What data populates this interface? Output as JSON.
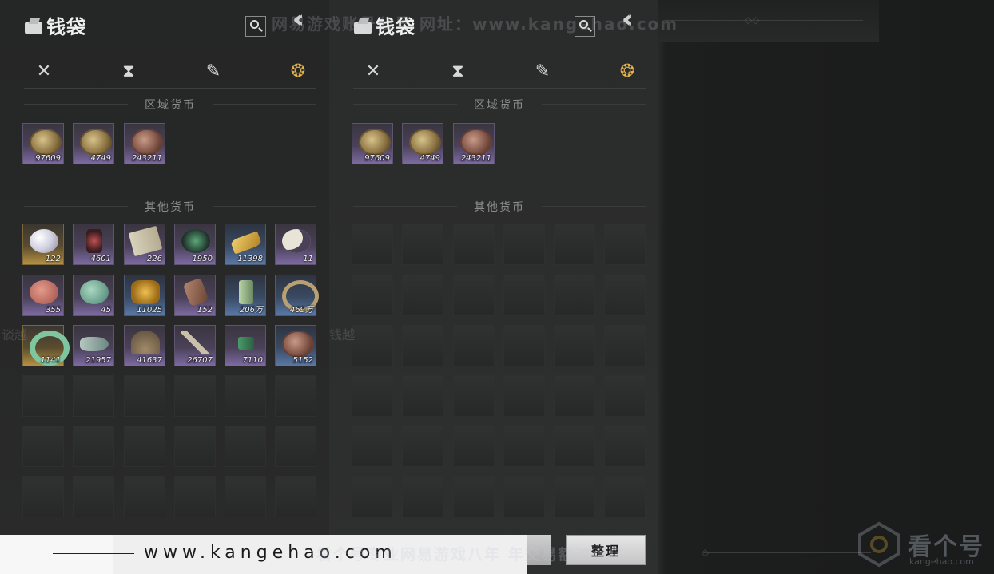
{
  "watermarks": {
    "top": "网易游戏账号公号  网址：www.kangehao.com",
    "bottom": "看个号专业网易游戏八年  年交易额过百亿",
    "logo_text": "看个号",
    "logo_sub": "kangehao.com",
    "side_left": "谈越",
    "side_right": "钱越",
    "url": "www.kangehao.com"
  },
  "panels": [
    {
      "title": "钱袋",
      "tabs": [
        {
          "name": "weapons",
          "glyph": "✕",
          "active": false
        },
        {
          "name": "bag",
          "glyph": "⧗",
          "active": false
        },
        {
          "name": "scroll",
          "glyph": "✎",
          "active": false
        },
        {
          "name": "currency",
          "glyph": "❂",
          "active": true
        }
      ],
      "section_regional": "区域货币",
      "section_other": "其他货币",
      "regional": [
        {
          "icon": "coin",
          "qty": "97609",
          "quality": "purple"
        },
        {
          "icon": "coin",
          "qty": "4749",
          "quality": "purple"
        },
        {
          "icon": "coin-copper",
          "qty": "243211",
          "quality": "purple"
        }
      ],
      "other": [
        {
          "icon": "pearl",
          "qty": "122",
          "quality": "gold"
        },
        {
          "icon": "crystal",
          "qty": "4601",
          "quality": "purple"
        },
        {
          "icon": "paper",
          "qty": "226",
          "quality": "purple"
        },
        {
          "icon": "sprout",
          "qty": "1950",
          "quality": "purple"
        },
        {
          "icon": "goldbar",
          "qty": "11398",
          "quality": "blue"
        },
        {
          "icon": "moon",
          "qty": "11",
          "quality": "purple"
        },
        {
          "icon": "pinkball",
          "qty": "355",
          "quality": "purple"
        },
        {
          "icon": "jadeball",
          "qty": "45",
          "quality": "purple"
        },
        {
          "icon": "goldleaf",
          "qty": "11025",
          "quality": "blue"
        },
        {
          "icon": "brownbar",
          "qty": "152",
          "quality": "purple"
        },
        {
          "icon": "ticket",
          "qty": "206万",
          "quality": "blue"
        },
        {
          "icon": "bracelet",
          "qty": "469万",
          "quality": "blue"
        },
        {
          "icon": "jadering",
          "qty": "1141",
          "quality": "gold"
        },
        {
          "icon": "fish",
          "qty": "21957",
          "quality": "purple"
        },
        {
          "icon": "dome",
          "qty": "41637",
          "quality": "purple"
        },
        {
          "icon": "key",
          "qty": "26707",
          "quality": "purple"
        },
        {
          "icon": "note",
          "qty": "7110",
          "quality": "purple"
        },
        {
          "icon": "coin-copper",
          "qty": "5152",
          "quality": "blue"
        }
      ],
      "empty_rows": 3
    },
    {
      "title": "钱袋",
      "tabs": [
        {
          "name": "weapons",
          "glyph": "✕",
          "active": false
        },
        {
          "name": "bag",
          "glyph": "⧗",
          "active": false
        },
        {
          "name": "scroll",
          "glyph": "✎",
          "active": false
        },
        {
          "name": "currency",
          "glyph": "❂",
          "active": true
        }
      ],
      "section_regional": "区域货币",
      "section_other": "其他货币",
      "regional": [
        {
          "icon": "coin",
          "qty": "97609",
          "quality": "purple"
        },
        {
          "icon": "coin",
          "qty": "4749",
          "quality": "purple"
        },
        {
          "icon": "coin-copper",
          "qty": "243211",
          "quality": "purple"
        }
      ],
      "other": [],
      "empty_rows": 6
    }
  ],
  "sort_button": "整理"
}
